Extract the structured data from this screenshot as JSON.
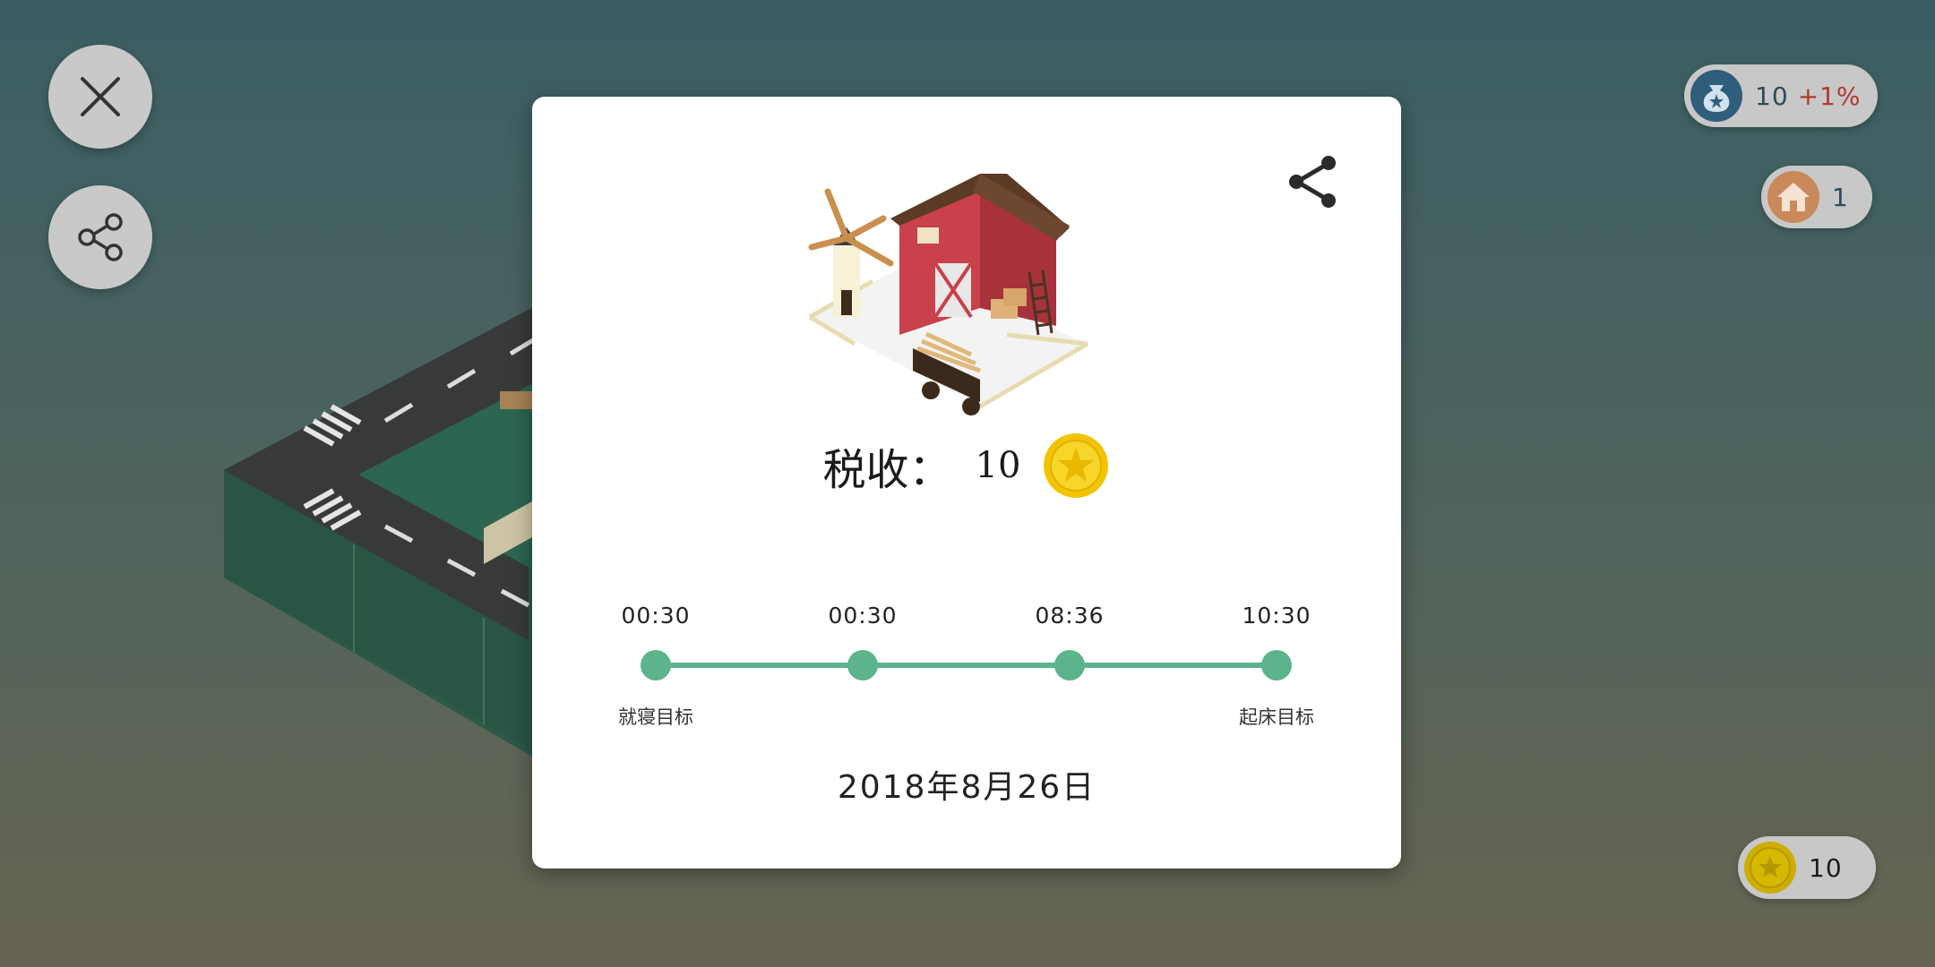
{
  "header": {
    "close_icon": "close-icon",
    "share_icon": "share-icon"
  },
  "status": {
    "money_bag": {
      "icon": "money-bag-icon",
      "value": "10",
      "bonus": "+1%"
    },
    "houses": {
      "icon": "house-icon",
      "value": "1"
    },
    "coins": {
      "icon": "coin-icon",
      "value": "10"
    }
  },
  "modal": {
    "share_icon": "share-icon",
    "illustration": "farm-building-illustration",
    "tax_label": "税收：",
    "tax_value": "10",
    "tax_icon": "coin-icon",
    "timeline": {
      "times": [
        "00:30",
        "00:30",
        "08:36",
        "10:30"
      ],
      "start_caption": "就寝目标",
      "end_caption": "起床目标"
    },
    "date": "2018年8月26日"
  },
  "colors": {
    "accent_green": "#5bb48c",
    "coin_gold": "#f2c400",
    "text_blue": "#2f4a5a",
    "bonus_red": "#b03a2e"
  }
}
